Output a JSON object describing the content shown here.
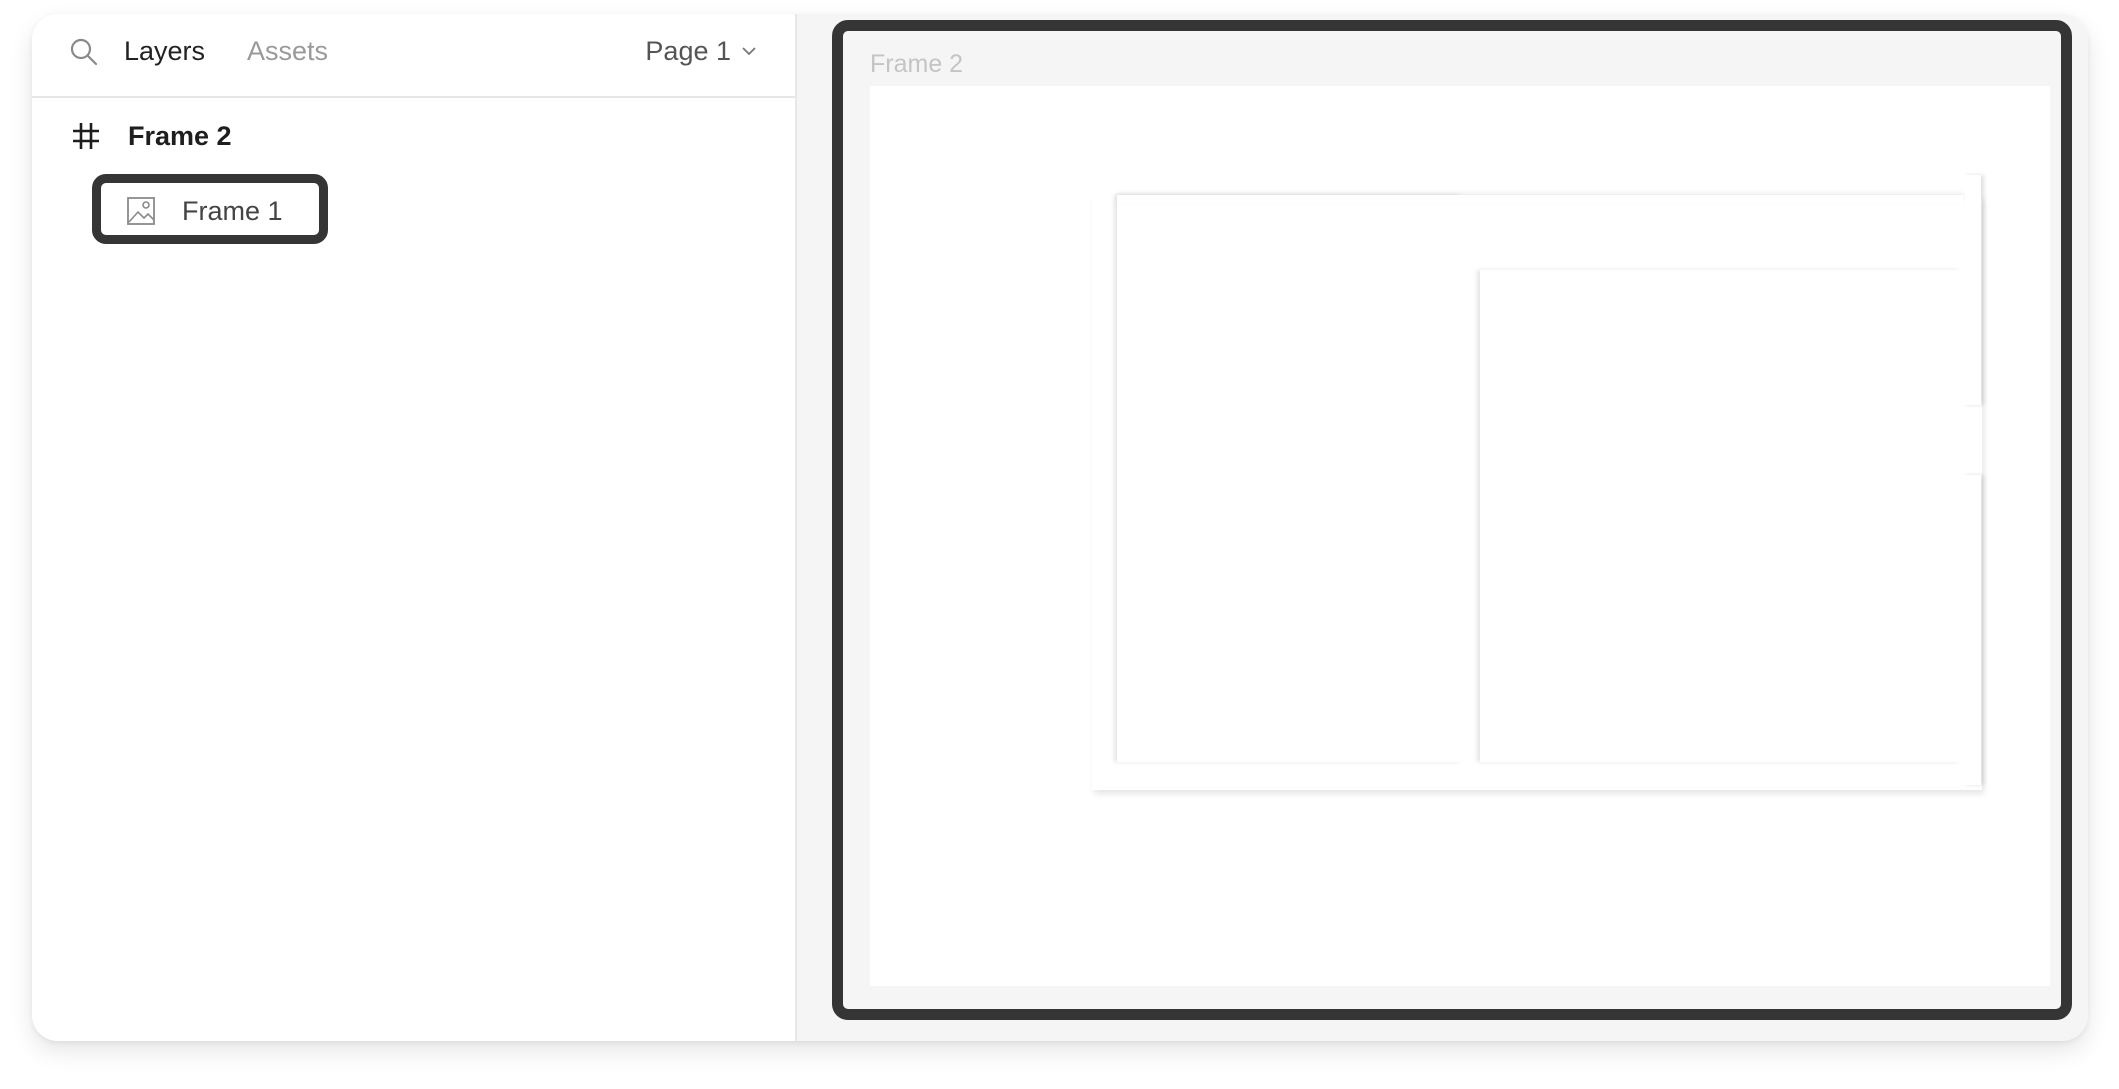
{
  "header": {
    "tabs": [
      {
        "label": "Layers",
        "active": true
      },
      {
        "label": "Assets",
        "active": false
      }
    ],
    "page_selector": "Page 1",
    "search_icon": "search-icon",
    "chevron_icon": "chevron-down-icon"
  },
  "layers": {
    "parent": {
      "label": "Frame 2",
      "icon": "frame-hash-icon"
    },
    "child": {
      "label": "Frame 1",
      "icon": "image-icon",
      "highlighted": true
    }
  },
  "canvas": {
    "frame_label": "Frame 2"
  },
  "colors": {
    "highlight_border": "#353535",
    "canvas_bg": "#f5f5f5",
    "active_tab": "#222222",
    "inactive_tab": "#9a9a9a"
  }
}
